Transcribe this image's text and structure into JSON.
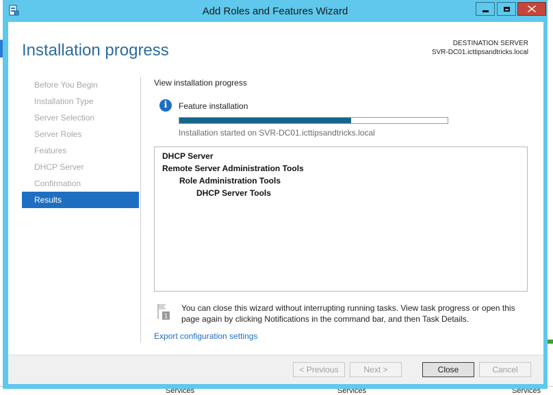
{
  "window": {
    "title": "Add Roles and Features Wizard"
  },
  "header": {
    "title": "Installation progress",
    "destination_label": "DESTINATION SERVER",
    "destination_server": "SVR-DC01.icttipsandtricks.local"
  },
  "nav": {
    "items": [
      {
        "label": "Before You Begin",
        "active": false
      },
      {
        "label": "Installation Type",
        "active": false
      },
      {
        "label": "Server Selection",
        "active": false
      },
      {
        "label": "Server Roles",
        "active": false
      },
      {
        "label": "Features",
        "active": false
      },
      {
        "label": "DHCP Server",
        "active": false
      },
      {
        "label": "Confirmation",
        "active": false
      },
      {
        "label": "Results",
        "active": true
      }
    ]
  },
  "content": {
    "section_label": "View installation progress",
    "feature_label": "Feature installation",
    "progress_fraction": 0.64,
    "started_text": "Installation started on SVR-DC01.icttipsandtricks.local",
    "results": [
      {
        "label": "DHCP Server",
        "level": 0
      },
      {
        "label": "Remote Server Administration Tools",
        "level": 0
      },
      {
        "label": "Role Administration Tools",
        "level": 1
      },
      {
        "label": "DHCP Server Tools",
        "level": 2
      }
    ],
    "notice_text": "You can close this wizard without interrupting running tasks. View task progress or open this page again by clicking Notifications in the command bar, and then Task Details.",
    "notice_badge": "1",
    "export_link": "Export configuration settings"
  },
  "footer": {
    "previous_label": "< Previous",
    "next_label": "Next >",
    "close_label": "Close",
    "cancel_label": "Cancel"
  },
  "background": {
    "bottom_left_label": "Services",
    "bottom_mid_label": "Services",
    "bottom_right_label": "Services"
  },
  "colors": {
    "titlebar": "#5fc8ec",
    "accent": "#1e6fc2",
    "header_text": "#2d6d9b",
    "progress_fill": "#16668c",
    "close_button": "#c7463b"
  },
  "icons": {
    "app": "server-manager-icon",
    "info": "info-icon",
    "notice": "flag-notification-icon"
  }
}
